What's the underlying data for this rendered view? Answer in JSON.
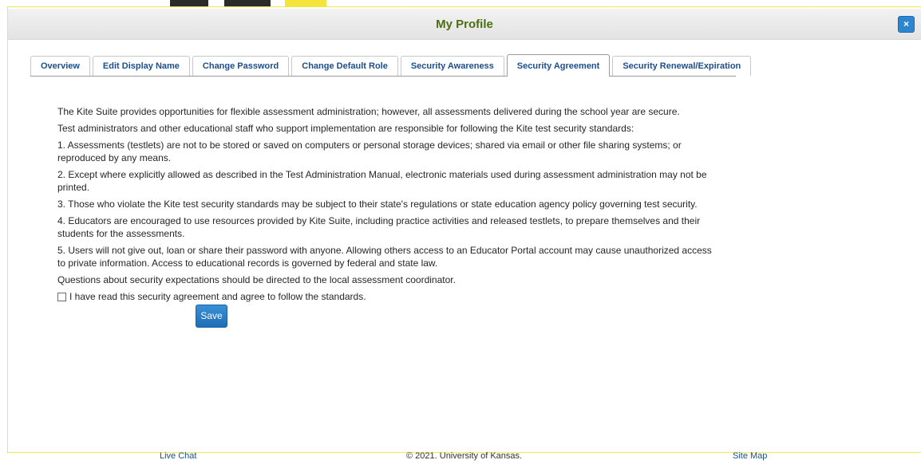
{
  "dialog": {
    "title": "My Profile",
    "close_icon": "close-icon",
    "close_glyph": "×"
  },
  "tabs": [
    {
      "label": "Overview",
      "active": false
    },
    {
      "label": "Edit Display Name",
      "active": false
    },
    {
      "label": "Change Password",
      "active": false
    },
    {
      "label": "Change Default Role",
      "active": false
    },
    {
      "label": "Security Awareness",
      "active": false
    },
    {
      "label": "Security Agreement",
      "active": true
    },
    {
      "label": "Security Renewal/Expiration",
      "active": false
    }
  ],
  "agreement": {
    "paragraphs": [
      "The Kite Suite provides opportunities for flexible assessment administration; however, all assessments delivered during the school year are secure.",
      "Test administrators and other educational staff who support implementation are responsible for following the Kite test security standards:",
      "1. Assessments (testlets) are not to be stored or saved on computers or personal storage devices; shared via email or other file sharing systems; or reproduced by any means.",
      "2. Except where explicitly allowed as described in the Test Administration Manual, electronic materials used during assessment administration may not be printed.",
      "3. Those who violate the Kite test security standards may be subject to their state's regulations or state education agency policy governing test security.",
      "4. Educators are encouraged to use resources provided by Kite Suite, including practice activities and released testlets, to prepare themselves and their students for the assessments.",
      "5. Users will not give out, loan or share their password with anyone. Allowing others access to an Educator Portal account may cause unauthorized access to private information. Access to educational records is governed by federal and state law.",
      "Questions about security expectations should be directed to the local assessment coordinator."
    ],
    "checkbox_label": "I have read this security agreement and agree to follow the standards.",
    "checkbox_checked": false,
    "save_label": "Save"
  },
  "footer": {
    "live_chat": "Live Chat",
    "copyright": "© 2021. University of Kansas.",
    "site_map": "Site Map"
  },
  "colors": {
    "title": "#4a6f12",
    "tab_text": "#1c4e8c",
    "accent_button": "#2d86cf",
    "dialog_border": "#f1e94c"
  }
}
